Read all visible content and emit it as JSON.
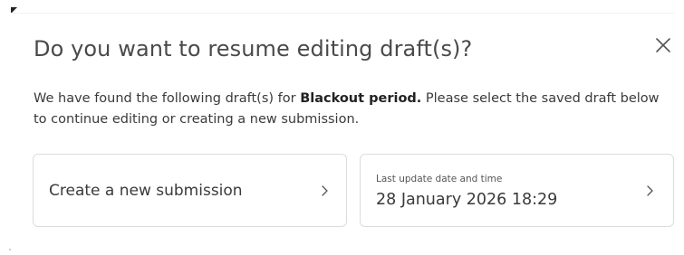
{
  "dialog": {
    "title": "Do you want to resume editing draft(s)?",
    "close_icon": "close-icon",
    "description": {
      "before": "We have found the following draft(s) for ",
      "bold": "Blackout period.",
      "after": " Please select the saved draft below to continue editing or creating a new submission."
    }
  },
  "cards": {
    "new_submission": {
      "label": "Create a new submission",
      "icon": "chevron-right-icon"
    },
    "draft": {
      "meta_label": "Last update date and time",
      "date": "28 January 2026 18:29",
      "icon": "chevron-right-icon"
    }
  },
  "colors": {
    "text": "#3a3a3a",
    "title": "#4a4a4a",
    "border": "#dcdcdc"
  }
}
